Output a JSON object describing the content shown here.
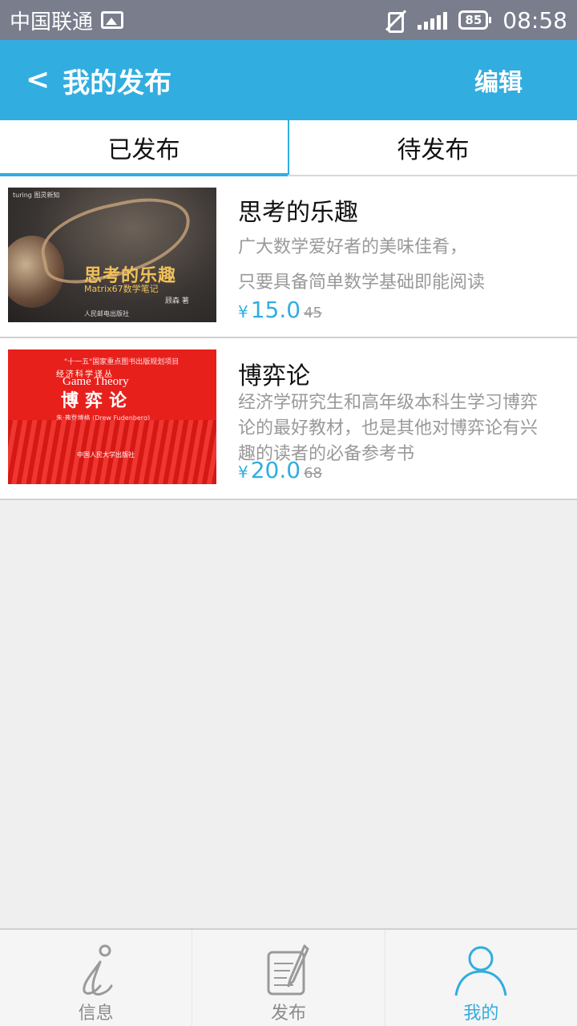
{
  "status_bar": {
    "carrier": "中国联通",
    "battery": "85",
    "time": "08:58",
    "icons": [
      "image-icon",
      "vibrate-off-icon",
      "signal-icon",
      "battery-icon"
    ]
  },
  "app_bar": {
    "back": "<",
    "title": "我的发布",
    "edit": "编辑"
  },
  "tabs": [
    {
      "label": "已发布",
      "active": true
    },
    {
      "label": "待发布",
      "active": false
    }
  ],
  "listings": [
    {
      "title": "思考的乐趣",
      "desc_lines": [
        "广大数学爱好者的美味佳肴，",
        "只要具备简单数学基础即能阅读"
      ],
      "currency": "¥",
      "price": "15.0",
      "original_price": "45"
    },
    {
      "title": "博弈论",
      "desc_lines": [
        "经济学研究生和高年级本科生学习博弈",
        "论的最好教材，也是其他对博弈论有兴",
        "趣的读者的必备参考书"
      ],
      "currency": "¥",
      "price": "20.0",
      "original_price": "68"
    }
  ],
  "bottom_nav": [
    {
      "label": "信息",
      "icon": "info-icon",
      "active": false
    },
    {
      "label": "发布",
      "icon": "publish-icon",
      "active": false
    },
    {
      "label": "我的",
      "icon": "profile-icon",
      "active": true
    }
  ],
  "colors": {
    "accent": "#31ade0",
    "status_bar": "#7a7d8c",
    "background": "#efefef"
  }
}
